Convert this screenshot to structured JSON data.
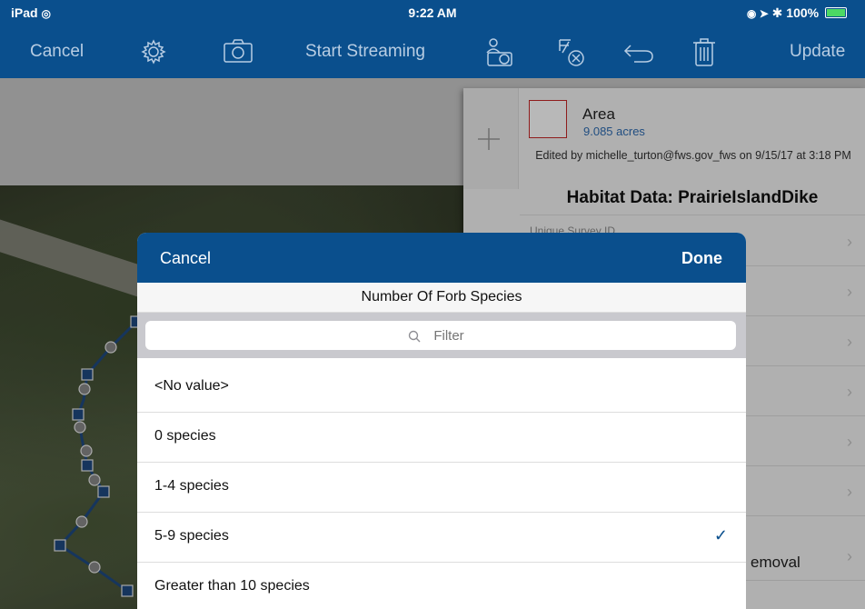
{
  "status_bar": {
    "device": "iPad",
    "time": "9:22 AM",
    "battery": "100%"
  },
  "toolbar": {
    "cancel_label": "Cancel",
    "start_streaming_label": "Start Streaming",
    "update_label": "Update"
  },
  "panel": {
    "area_label": "Area",
    "area_value": "9.085 acres",
    "edited_by": "Edited by michelle_turton@fws.gov_fws on 9/15/17 at 3:18 PM",
    "habitat_title": "Habitat Data: PrairieIslandDike",
    "unique_survey_label": "Unique Survey ID",
    "removal_text": "emoval"
  },
  "modal": {
    "cancel_label": "Cancel",
    "done_label": "Done",
    "title": "Number Of Forb Species",
    "filter_placeholder": "Filter",
    "options": [
      {
        "label": "<No value>",
        "selected": false
      },
      {
        "label": "0 species",
        "selected": false
      },
      {
        "label": "1-4 species",
        "selected": false
      },
      {
        "label": "5-9 species",
        "selected": true
      },
      {
        "label": "Greater than 10 species",
        "selected": false
      }
    ],
    "check_mark": "✓"
  },
  "colors": {
    "accent": "#0a4f8d",
    "toolbar_text": "#b8cde3",
    "area_value": "#2f6db3",
    "area_outline": "#c62828"
  },
  "icons": [
    "gear-icon",
    "camera-icon",
    "camera-person-icon",
    "sketch-clear-icon",
    "undo-icon",
    "trash-icon",
    "plus-icon",
    "search-icon",
    "checkmark-icon",
    "chevron-right-icon",
    "wifi-icon",
    "location-icon",
    "bluetooth-icon",
    "battery-icon"
  ]
}
